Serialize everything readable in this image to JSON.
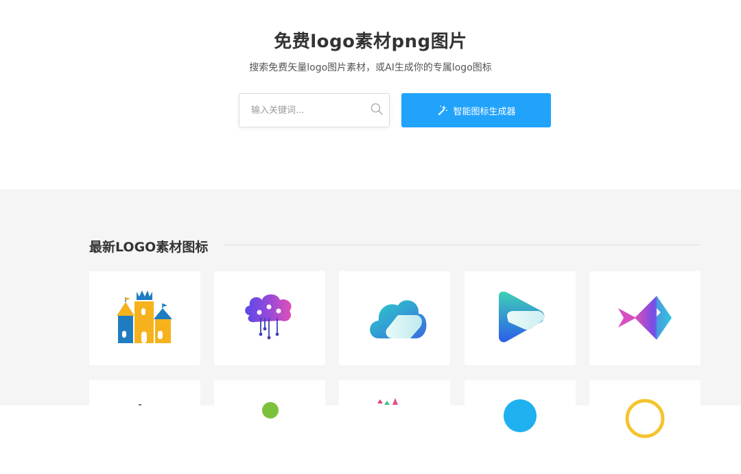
{
  "hero": {
    "title": "免费logo素材png图片",
    "subtitle": "搜索免费矢量logo图片素材，或AI生成你的专属logo图标"
  },
  "search": {
    "placeholder": "输入关键词...",
    "value": ""
  },
  "generator_button": {
    "label": "智能图标生成器"
  },
  "section": {
    "title": "最新LOGO素材图标"
  },
  "colors": {
    "accent": "#21a3fc",
    "gallery_bg": "#f5f5f5"
  },
  "cards_row1": [
    {
      "icon": "castle-icon"
    },
    {
      "icon": "brain-tree-icon"
    },
    {
      "icon": "cloud-icon"
    },
    {
      "icon": "play-icon"
    },
    {
      "icon": "fish-icon"
    }
  ],
  "cards_row2": [
    {
      "icon": "partial-logo-icon"
    },
    {
      "icon": "partial-logo-icon"
    },
    {
      "icon": "partial-logo-icon"
    },
    {
      "icon": "partial-logo-icon"
    },
    {
      "icon": "partial-logo-icon"
    }
  ]
}
